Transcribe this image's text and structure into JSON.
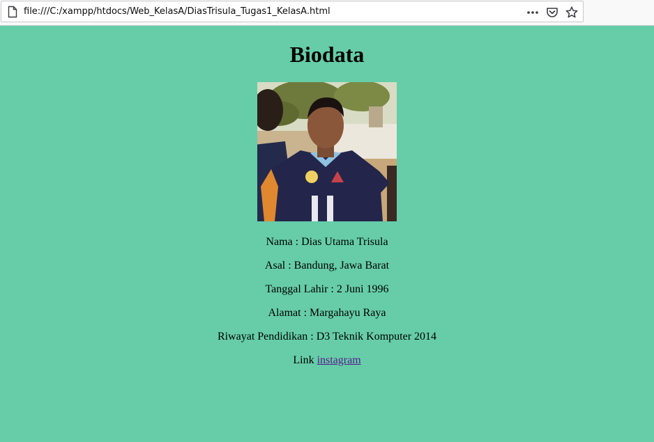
{
  "browser": {
    "url": "file:///C:/xampp/htdocs/Web_KelasA/DiasTrisula_Tugas1_KelasA.html",
    "actions": [
      "more-icon",
      "pocket-icon",
      "bookmark-star-icon"
    ]
  },
  "page": {
    "title": "Biodata",
    "background": "#66cda8",
    "rows": [
      "Nama : Dias Utama Trisula",
      "Asal : Bandung, Jawa Barat",
      "Tanggal Lahir : 2 Juni 1996",
      "Alamat : Margahayu Raya",
      "Riwayat Pendidikan : D3 Teknik Komputer 2014"
    ],
    "link_prefix": "Link",
    "link_text": "instagram"
  }
}
